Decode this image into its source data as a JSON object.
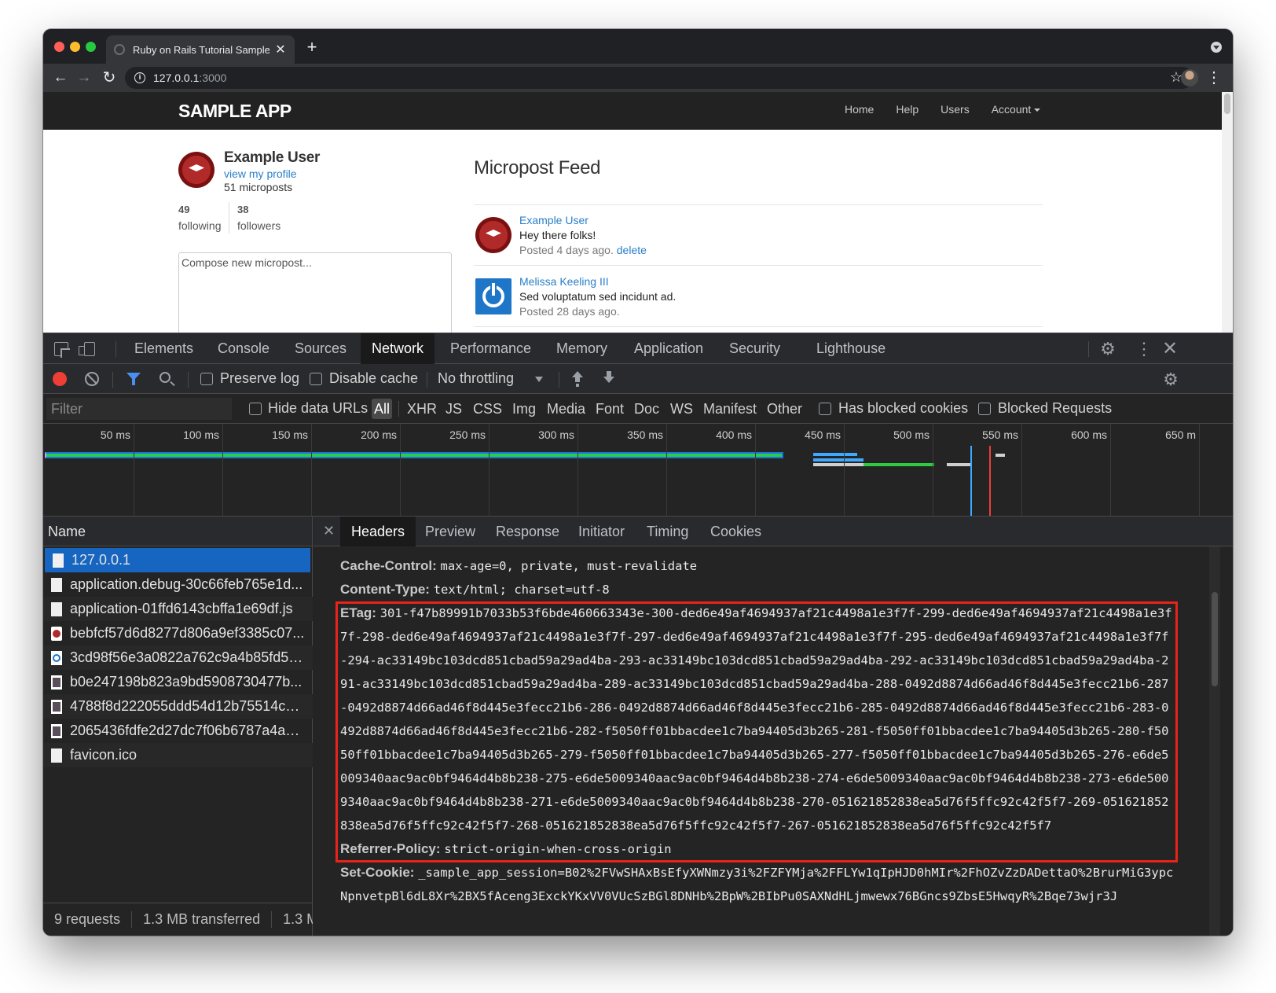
{
  "browser": {
    "tab_title": "Ruby on Rails Tutorial Sample App",
    "url_host": "127.0.0.1",
    "url_port": ":3000"
  },
  "app": {
    "logo": "SAMPLE APP",
    "nav": [
      {
        "label": "Home"
      },
      {
        "label": "Help"
      },
      {
        "label": "Users"
      },
      {
        "label": "Account"
      }
    ],
    "user": {
      "name": "Example User",
      "view_profile": "view my profile",
      "microposts": "51 microposts",
      "following_count": "49",
      "following_label": "following",
      "followers_count": "38",
      "followers_label": "followers"
    },
    "compose_placeholder": "Compose new micropost...",
    "feed_title": "Micropost Feed",
    "posts": [
      {
        "user": "Example User",
        "content": "Hey there folks!",
        "time": "Posted 4 days ago.",
        "action": "delete"
      },
      {
        "user": "Melissa Keeling III",
        "content": "Sed voluptatum sed incidunt ad.",
        "time": "Posted 28 days ago."
      }
    ]
  },
  "devtools": {
    "tabs": [
      {
        "label": "Elements"
      },
      {
        "label": "Console"
      },
      {
        "label": "Sources"
      },
      {
        "label": "Network"
      },
      {
        "label": "Performance"
      },
      {
        "label": "Memory"
      },
      {
        "label": "Application"
      },
      {
        "label": "Security"
      },
      {
        "label": "Lighthouse"
      }
    ],
    "active_tab": "Network",
    "toolbar": {
      "preserve_log": "Preserve log",
      "disable_cache": "Disable cache",
      "throttling": "No throttling"
    },
    "filter": {
      "placeholder": "Filter",
      "hide_data_urls": "Hide data URLs",
      "types": [
        "All",
        "XHR",
        "JS",
        "CSS",
        "Img",
        "Media",
        "Font",
        "Doc",
        "WS",
        "Manifest",
        "Other"
      ],
      "has_blocked_cookies": "Has blocked cookies",
      "blocked_requests": "Blocked Requests"
    },
    "timeline_ticks": [
      "50 ms",
      "100 ms",
      "150 ms",
      "200 ms",
      "250 ms",
      "300 ms",
      "350 ms",
      "400 ms",
      "450 ms",
      "500 ms",
      "550 ms",
      "600 ms",
      "650 m"
    ],
    "name_header": "Name",
    "requests": [
      {
        "name": "127.0.0.1",
        "icon": "document-icon"
      },
      {
        "name": "application.debug-30c66feb765e1d...",
        "icon": "document-icon"
      },
      {
        "name": "application-01ffd6143cbffa1e69df.js",
        "icon": "document-icon"
      },
      {
        "name": "bebfcf57d6d8277d806a9ef3385c07...",
        "icon": "image-icon"
      },
      {
        "name": "3cd98f56e3a0822a762c9a4b85fd56...",
        "icon": "image-icon"
      },
      {
        "name": "b0e247198b823a9bd5908730477b...",
        "icon": "image-icon"
      },
      {
        "name": "4788f8d222055ddd54d12b75514cd...",
        "icon": "image-icon"
      },
      {
        "name": "2065436fdfe2d27dc7f06b6787a4a1...",
        "icon": "image-icon"
      },
      {
        "name": "favicon.ico",
        "icon": "document-icon"
      }
    ],
    "status": {
      "requests": "9 requests",
      "transferred": "1.3 MB transferred",
      "resources": "1.3 M"
    },
    "detail_tabs": [
      {
        "label": "Headers"
      },
      {
        "label": "Preview"
      },
      {
        "label": "Response"
      },
      {
        "label": "Initiator"
      },
      {
        "label": "Timing"
      },
      {
        "label": "Cookies"
      }
    ],
    "headers": [
      {
        "key": "Cache-Control:",
        "value": "max-age=0, private, must-revalidate"
      },
      {
        "key": "Content-Type:",
        "value": "text/html; charset=utf-8"
      },
      {
        "key": "ETag:",
        "value": "301-f47b89991b7033b53f6bde460663343e-300-ded6e49af4694937af21c4498a1e3f7f-299-ded6e49af4694937af21c4498a1e3f7f-298-ded6e49af4694937af21c4498a1e3f7f-297-ded6e49af4694937af21c4498a1e3f7f-295-ded6e49af4694937af21c4498a1e3f7f-294-ac33149bc103dcd851cbad59a29ad4ba-293-ac33149bc103dcd851cbad59a29ad4ba-292-ac33149bc103dcd851cbad59a29ad4ba-291-ac33149bc103dcd851cbad59a29ad4ba-289-ac33149bc103dcd851cbad59a29ad4ba-288-0492d8874d66ad46f8d445e3fecc21b6-287-0492d8874d66ad46f8d445e3fecc21b6-286-0492d8874d66ad46f8d445e3fecc21b6-285-0492d8874d66ad46f8d445e3fecc21b6-283-0492d8874d66ad46f8d445e3fecc21b6-282-f5050ff01bbacdee1c7ba94405d3b265-281-f5050ff01bbacdee1c7ba94405d3b265-280-f5050ff01bbacdee1c7ba94405d3b265-279-f5050ff01bbacdee1c7ba94405d3b265-277-f5050ff01bbacdee1c7ba94405d3b265-276-e6de5009340aac9ac0bf9464d4b8b238-275-e6de5009340aac9ac0bf9464d4b8b238-274-e6de5009340aac9ac0bf9464d4b8b238-273-e6de5009340aac9ac0bf9464d4b8b238-271-e6de5009340aac9ac0bf9464d4b8b238-270-051621852838ea5d76f5ffc92c42f5f7-269-051621852838ea5d76f5ffc92c42f5f7-268-051621852838ea5d76f5ffc92c42f5f7-267-051621852838ea5d76f5ffc92c42f5f7"
      },
      {
        "key": "Referrer-Policy:",
        "value": "strict-origin-when-cross-origin"
      },
      {
        "key": "Set-Cookie:",
        "value": "_sample_app_session=B02%2FVwSHAxBsEfyXWNmzy3i%2FZFYMja%2FFLYw1qIpHJD0hMIr%2FhOZvZzDADettaO%2BrurMiG3ypcNpnvetpBl6dL8Xr%2BX5fAceng3ExckYKxVV0VUcSzBGl8DNHb%2BpW%2BIbPu0SAXNdHLjmwewx76BGncs9ZbsE5HwqyR%2Bqe73wjr3J"
      }
    ]
  }
}
